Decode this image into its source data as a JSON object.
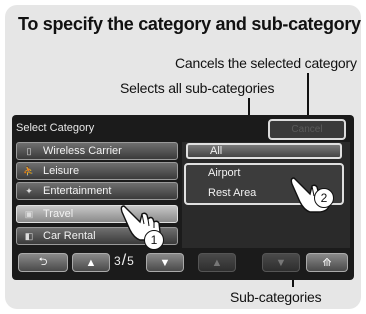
{
  "title": "To specify the category and sub-category",
  "callouts": {
    "cancel": "Cancels the selected category",
    "select_all": "Selects all sub-categories",
    "sub_categories": "Sub-categories"
  },
  "screen": {
    "title": "Select Category",
    "cancel_label": "Cancel",
    "categories": [
      {
        "label": "Wireless Carrier",
        "icon": "phone-icon"
      },
      {
        "label": "Leisure",
        "icon": "person-icon"
      },
      {
        "label": "Entertainment",
        "icon": "film-icon"
      },
      {
        "label": "Travel",
        "icon": "suitcase-icon",
        "selected": true
      },
      {
        "label": "Car Rental",
        "icon": "car-icon"
      }
    ],
    "all_label": "All",
    "sub_items": [
      "Airport",
      "Rest Area"
    ],
    "page": {
      "current": "3",
      "total": "5"
    }
  },
  "steps": [
    "1",
    "2"
  ],
  "colors": {
    "background": "#e6e6e6",
    "screen": "#1b1b1b",
    "highlight": "#e0e0e0"
  }
}
